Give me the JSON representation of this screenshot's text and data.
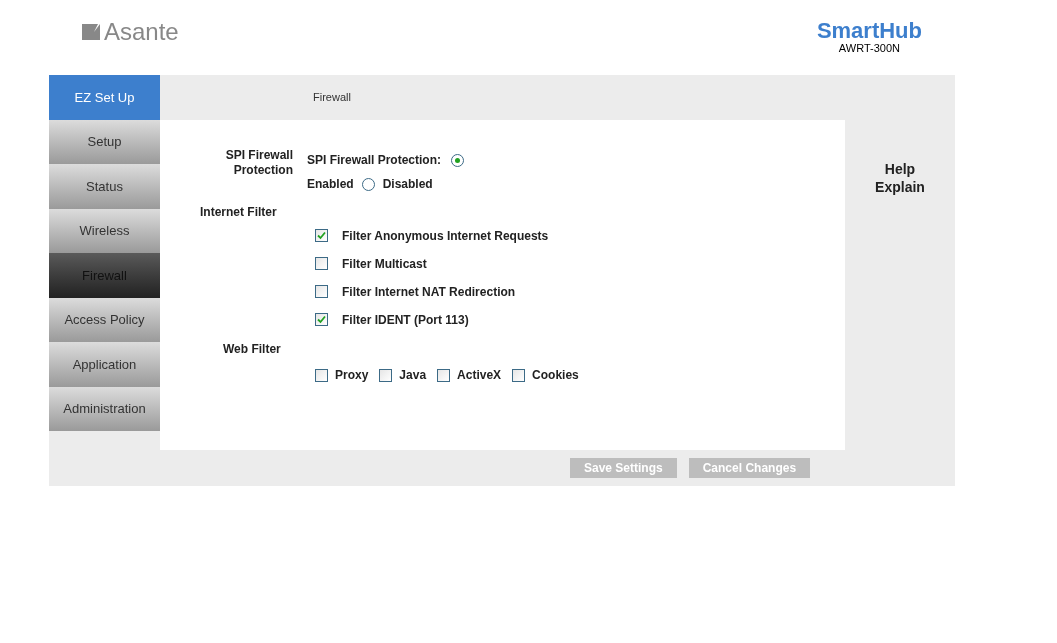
{
  "header": {
    "brand": "Asante",
    "product": "SmartHub",
    "model": "AWRT-300N"
  },
  "nav": [
    {
      "label": "EZ Set Up",
      "kind": "featured",
      "selected": false
    },
    {
      "label": "Setup",
      "kind": "normal",
      "selected": false
    },
    {
      "label": "Status",
      "kind": "normal",
      "selected": false
    },
    {
      "label": "Wireless",
      "kind": "normal",
      "selected": false
    },
    {
      "label": "Firewall",
      "kind": "normal",
      "selected": true
    },
    {
      "label": "Access Policy",
      "kind": "normal",
      "selected": false
    },
    {
      "label": "Application",
      "kind": "normal",
      "selected": false
    },
    {
      "label": "Administration",
      "kind": "normal",
      "selected": false
    }
  ],
  "page_title": "Firewall",
  "spi": {
    "label": "SPI Firewall Protection",
    "prompt": "SPI Firewall Protection:",
    "options": [
      {
        "label": "Enabled",
        "selected": true
      },
      {
        "label": "Disabled",
        "selected": false
      }
    ]
  },
  "internet_filter": {
    "label": "Internet Filter",
    "items": [
      {
        "label": "Filter Anonymous Internet Requests",
        "checked": true
      },
      {
        "label": "Filter Multicast",
        "checked": false
      },
      {
        "label": "Filter Internet NAT Redirection",
        "checked": false
      },
      {
        "label": "Filter IDENT (Port 113)",
        "checked": true
      }
    ]
  },
  "web_filter": {
    "label": "Web Filter",
    "items": [
      {
        "label": "Proxy",
        "checked": false
      },
      {
        "label": "Java",
        "checked": false
      },
      {
        "label": "ActiveX",
        "checked": false
      },
      {
        "label": "Cookies",
        "checked": false
      }
    ]
  },
  "help": {
    "title": "Help Explain"
  },
  "buttons": [
    "Save Settings",
    "Cancel Changes"
  ]
}
